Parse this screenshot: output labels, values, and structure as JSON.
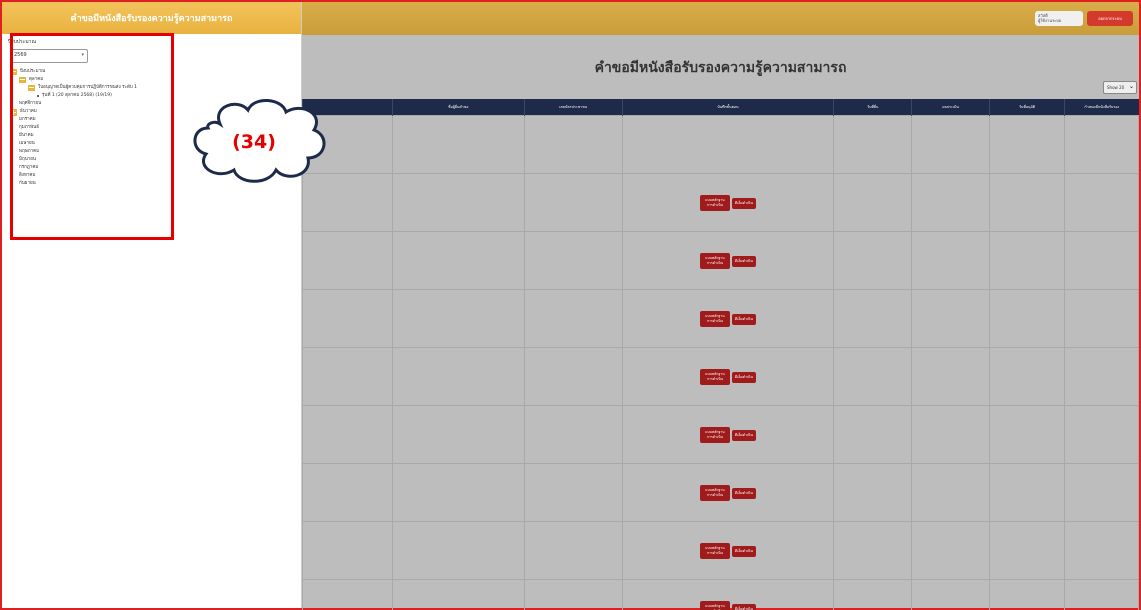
{
  "sidebar": {
    "header": "คำขอมีหนังสือรับรองความรู้ความสามารถ",
    "year_label": "ปีงบประมาณ",
    "year_value": "2569",
    "tree": [
      {
        "level": 0,
        "icon": "folder-open",
        "label": "ปีงบประมาณ"
      },
      {
        "level": 1,
        "icon": "folder-open",
        "label": "ตุลาคม"
      },
      {
        "level": 2,
        "icon": "folder-open",
        "label": "ใบอนุญาตเป็นผู้ควบคุมการปฏิบัติการขนส่ง ระดับ 1"
      },
      {
        "level": 3,
        "icon": "bullet",
        "label": "รุ่นที่ 1 (20 ตุลาคม 2568) (19/19)"
      },
      {
        "level": 1,
        "icon": "none",
        "label": "พฤศจิกายน"
      },
      {
        "level": 0,
        "icon": "plus",
        "label": "ธันวาคม"
      },
      {
        "level": 1,
        "icon": "none",
        "label": "มกราคม"
      },
      {
        "level": 1,
        "icon": "none",
        "label": "กุมภาพันธ์"
      },
      {
        "level": 1,
        "icon": "none",
        "label": "มีนาคม"
      },
      {
        "level": 1,
        "icon": "none",
        "label": "เมษายน"
      },
      {
        "level": 1,
        "icon": "none",
        "label": "พฤษภาคม"
      },
      {
        "level": 1,
        "icon": "none",
        "label": "มิถุนายน"
      },
      {
        "level": 1,
        "icon": "none",
        "label": "กรกฎาคม"
      },
      {
        "level": 1,
        "icon": "none",
        "label": "สิงหาคม"
      },
      {
        "level": 1,
        "icon": "none",
        "label": "กันยายน"
      }
    ]
  },
  "callout": {
    "label": "(34)"
  },
  "topbar": {
    "user_line1": "สวัสดี",
    "user_line2": "ผู้ใช้งานระบบ",
    "logout_label": "ออกจากระบบ"
  },
  "main": {
    "title": "คำขอมีหนังสือรับรองความรู้ความสามารถ",
    "show_select": "Show 20",
    "columns": [
      "",
      "ชื่อผู้ยื่นคำขอ",
      "เลขบัตรประชาชน",
      "บันทึกขั้นตอน",
      "วันที่ยื่น",
      "ผลประเมิน",
      "วันที่อนุมัติ",
      "กำหนดมีหนังสือรับรอง"
    ],
    "row_action_1": "แบบหลักฐาน การดำเนิน",
    "row_action_2": "ดีเอ็ดดำเนิน"
  },
  "colors": {
    "header_gold": "#e8b23f",
    "table_header": "#1e2a4a",
    "action_red": "#a01c1c",
    "annotation_red": "#e60000"
  }
}
